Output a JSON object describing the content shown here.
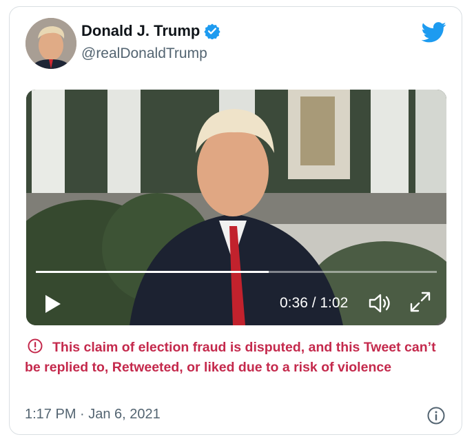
{
  "tweet": {
    "author_name": "Donald J. Trump",
    "handle": "@realDonaldTrump",
    "verified": true,
    "brand_icon": "twitter-bird-icon",
    "accent_color": "#1d9bf0",
    "timestamp": "1:17 PM · Jan 6, 2021"
  },
  "video": {
    "time_display": "0:36 / 1:02",
    "progress_fraction": 0.58,
    "controls": [
      "play-icon",
      "volume-icon",
      "fullscreen-icon"
    ]
  },
  "notice": {
    "text": "This claim of election fraud is disputed, and this Tweet can’t be replied to, Retweeted, or liked due to a risk of violence",
    "color": "#c4294c",
    "icon": "alert-circle-icon"
  },
  "footer": {
    "info_icon": "info-icon"
  }
}
